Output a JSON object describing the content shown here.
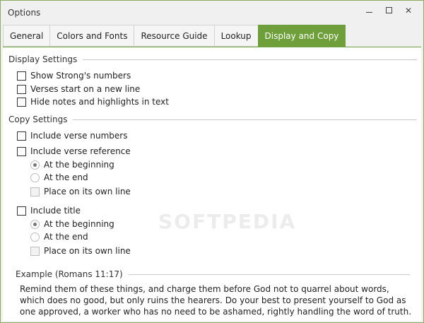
{
  "window": {
    "title": "Options"
  },
  "tabs": [
    {
      "label": "General"
    },
    {
      "label": "Colors and Fonts"
    },
    {
      "label": "Resource Guide"
    },
    {
      "label": "Lookup"
    },
    {
      "label": "Display and Copy",
      "active": true
    }
  ],
  "display_settings": {
    "header": "Display Settings",
    "options": [
      {
        "label": "Show Strong's numbers",
        "checked": false
      },
      {
        "label": "Verses start on a new line",
        "checked": false
      },
      {
        "label": "Hide notes and highlights in text",
        "checked": false
      }
    ]
  },
  "copy_settings": {
    "header": "Copy Settings",
    "include_verse_numbers": {
      "label": "Include verse numbers",
      "checked": false
    },
    "include_verse_reference": {
      "label": "Include verse reference",
      "checked": false,
      "position_options": [
        {
          "label": "At the beginning",
          "selected": true
        },
        {
          "label": "At the end",
          "selected": false
        }
      ],
      "own_line": {
        "label": "Place on its own line",
        "checked": false
      }
    },
    "include_title": {
      "label": "Include title",
      "checked": false,
      "position_options": [
        {
          "label": "At the beginning",
          "selected": true
        },
        {
          "label": "At the end",
          "selected": false
        }
      ],
      "own_line": {
        "label": "Place on its own line",
        "checked": false
      }
    }
  },
  "example": {
    "header": "Example (Romans 11:17)",
    "text": "Remind them of these things, and charge them before God not to quarrel about words, which does no good, but only ruins the hearers. Do your best to present yourself to God as one approved, a worker who has no need to be ashamed, rightly handling the word of truth."
  },
  "watermark": "SOFTPEDIA",
  "colors": {
    "accent": "#6f9f3a",
    "border": "#8cab60"
  }
}
